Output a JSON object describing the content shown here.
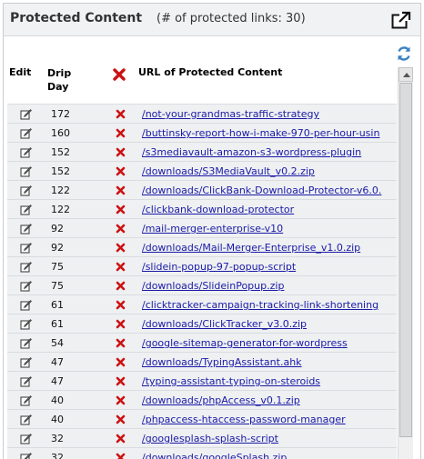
{
  "header": {
    "title": "Protected Content",
    "count_text": "(# of protected links: 30)"
  },
  "columns": {
    "edit": "Edit",
    "drip_line1": "Drip",
    "drip_line2": "Day",
    "delete_icon": "red-x-icon",
    "url": "URL of Protected Content"
  },
  "icons": {
    "popout": "popout-window-icon",
    "refresh": "refresh-icon",
    "edit": "pencil-edit-icon",
    "delete": "red-x-icon"
  },
  "colors": {
    "link": "#1a1aa6",
    "delete": "#cc1111",
    "row_bg": "#eef0f2",
    "header_bg": "#f1f2f3",
    "refresh": "#3b82c4"
  },
  "rows": [
    {
      "day": "172",
      "url": "/not-your-grandmas-traffic-strategy"
    },
    {
      "day": "160",
      "url": "/buttinsky-report-how-i-make-970-per-hour-usin"
    },
    {
      "day": "152",
      "url": "/s3mediavault-amazon-s3-wordpress-plugin"
    },
    {
      "day": "152",
      "url": "/downloads/S3MediaVault_v0.2.zip"
    },
    {
      "day": "122",
      "url": "/downloads/ClickBank-Download-Protector-v6.0."
    },
    {
      "day": "122",
      "url": "/clickbank-download-protector"
    },
    {
      "day": "92",
      "url": "/mail-merger-enterprise-v10"
    },
    {
      "day": "92",
      "url": "/downloads/Mail-Merger-Enterprise_v1.0.zip"
    },
    {
      "day": "75",
      "url": "/slidein-popup-97-popup-script"
    },
    {
      "day": "75",
      "url": "/downloads/SlideinPopup.zip"
    },
    {
      "day": "61",
      "url": "/clicktracker-campaign-tracking-link-shortening"
    },
    {
      "day": "61",
      "url": "/downloads/ClickTracker_v3.0.zip"
    },
    {
      "day": "54",
      "url": "/google-sitemap-generator-for-wordpress"
    },
    {
      "day": "47",
      "url": "/downloads/TypingAssistant.ahk"
    },
    {
      "day": "47",
      "url": "/typing-assistant-typing-on-steroids"
    },
    {
      "day": "40",
      "url": "/downloads/phpAccess_v0.1.zip"
    },
    {
      "day": "40",
      "url": "/phpaccess-htaccess-password-manager"
    },
    {
      "day": "32",
      "url": "/googlesplash-splash-script"
    },
    {
      "day": "32",
      "url": "/downloads/googleSplash.zip"
    }
  ]
}
